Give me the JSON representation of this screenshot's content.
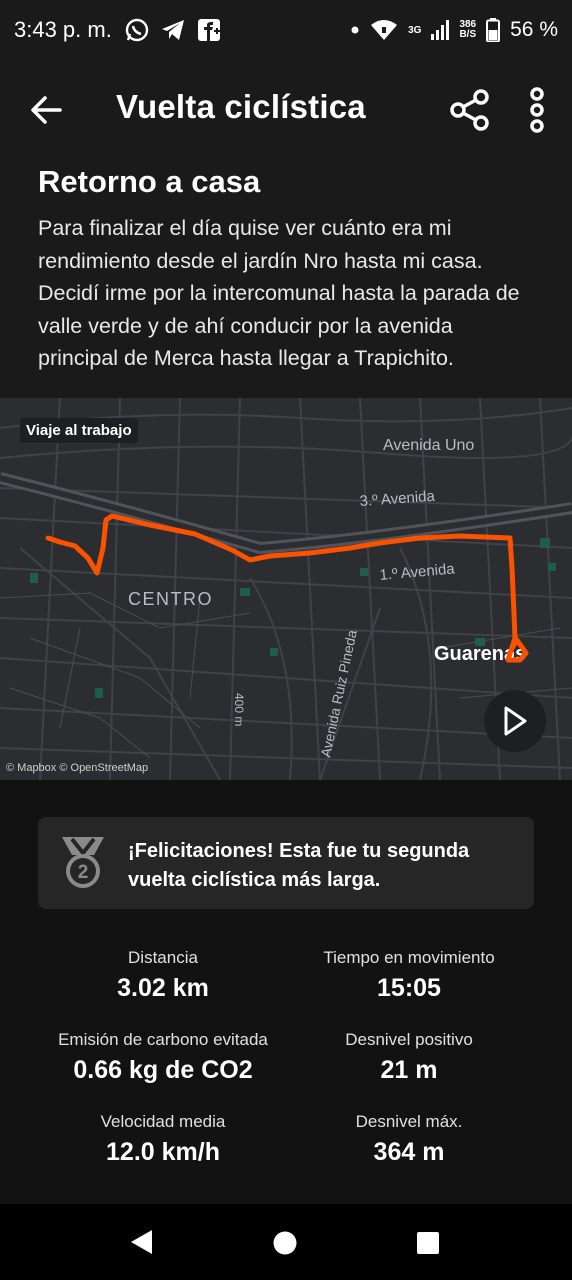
{
  "status_bar": {
    "time": "3:43 p. m.",
    "net_speed_top": "386",
    "net_speed_bottom": "B/S",
    "network_type": "3G",
    "battery_percent": "56 %",
    "icons": [
      "whatsapp-icon",
      "telegram-icon",
      "facebook-icon",
      "dot-icon",
      "wifi-icon",
      "signal-icon",
      "battery-icon"
    ]
  },
  "app_bar": {
    "title": "Vuelta ciclística",
    "icons": [
      "back-arrow-icon",
      "share-icon",
      "more-vert-icon"
    ]
  },
  "activity": {
    "title": "Retorno a casa",
    "description": "Para finalizar el día quise ver cuánto era mi rendimiento desde el jardín Nro hasta mi casa. Decidí irme por la intercomunal hasta la parada de valle verde y de ahí conducir por la avenida principal de Merca hasta llegar a Trapichito."
  },
  "map": {
    "tag": "Viaje al trabajo",
    "labels": {
      "avenida_uno": "Avenida Uno",
      "tercera_avenida": "3.º Avenida",
      "primera_avenida": "1.º Avenida",
      "centro": "CENTRO",
      "guarenas": "Guarenas",
      "ruiz_pineda": "Avenida Ruiz Pineda",
      "road_num": "400 m"
    },
    "attribution": "© Mapbox © OpenStreetMap",
    "route_color": "#fc5200",
    "play_icon": "play-icon"
  },
  "achievement": {
    "icon": "medal-2-icon",
    "badge_number": "2",
    "text": "¡Felicitaciones! Esta fue tu segunda vuelta ciclística más larga."
  },
  "stats": [
    {
      "label": "Distancia",
      "value": "3.02 km"
    },
    {
      "label": "Tiempo en movimiento",
      "value": "15:05"
    },
    {
      "label": "Emisión de carbono evitada",
      "value": "0.66 kg de CO2"
    },
    {
      "label": "Desnivel positivo",
      "value": "21 m"
    },
    {
      "label": "Velocidad media",
      "value": "12.0 km/h"
    },
    {
      "label": "Desnivel máx.",
      "value": "364 m"
    }
  ],
  "nav_bar": {
    "icons": [
      "nav-back-icon",
      "nav-home-icon",
      "nav-recents-icon"
    ]
  }
}
